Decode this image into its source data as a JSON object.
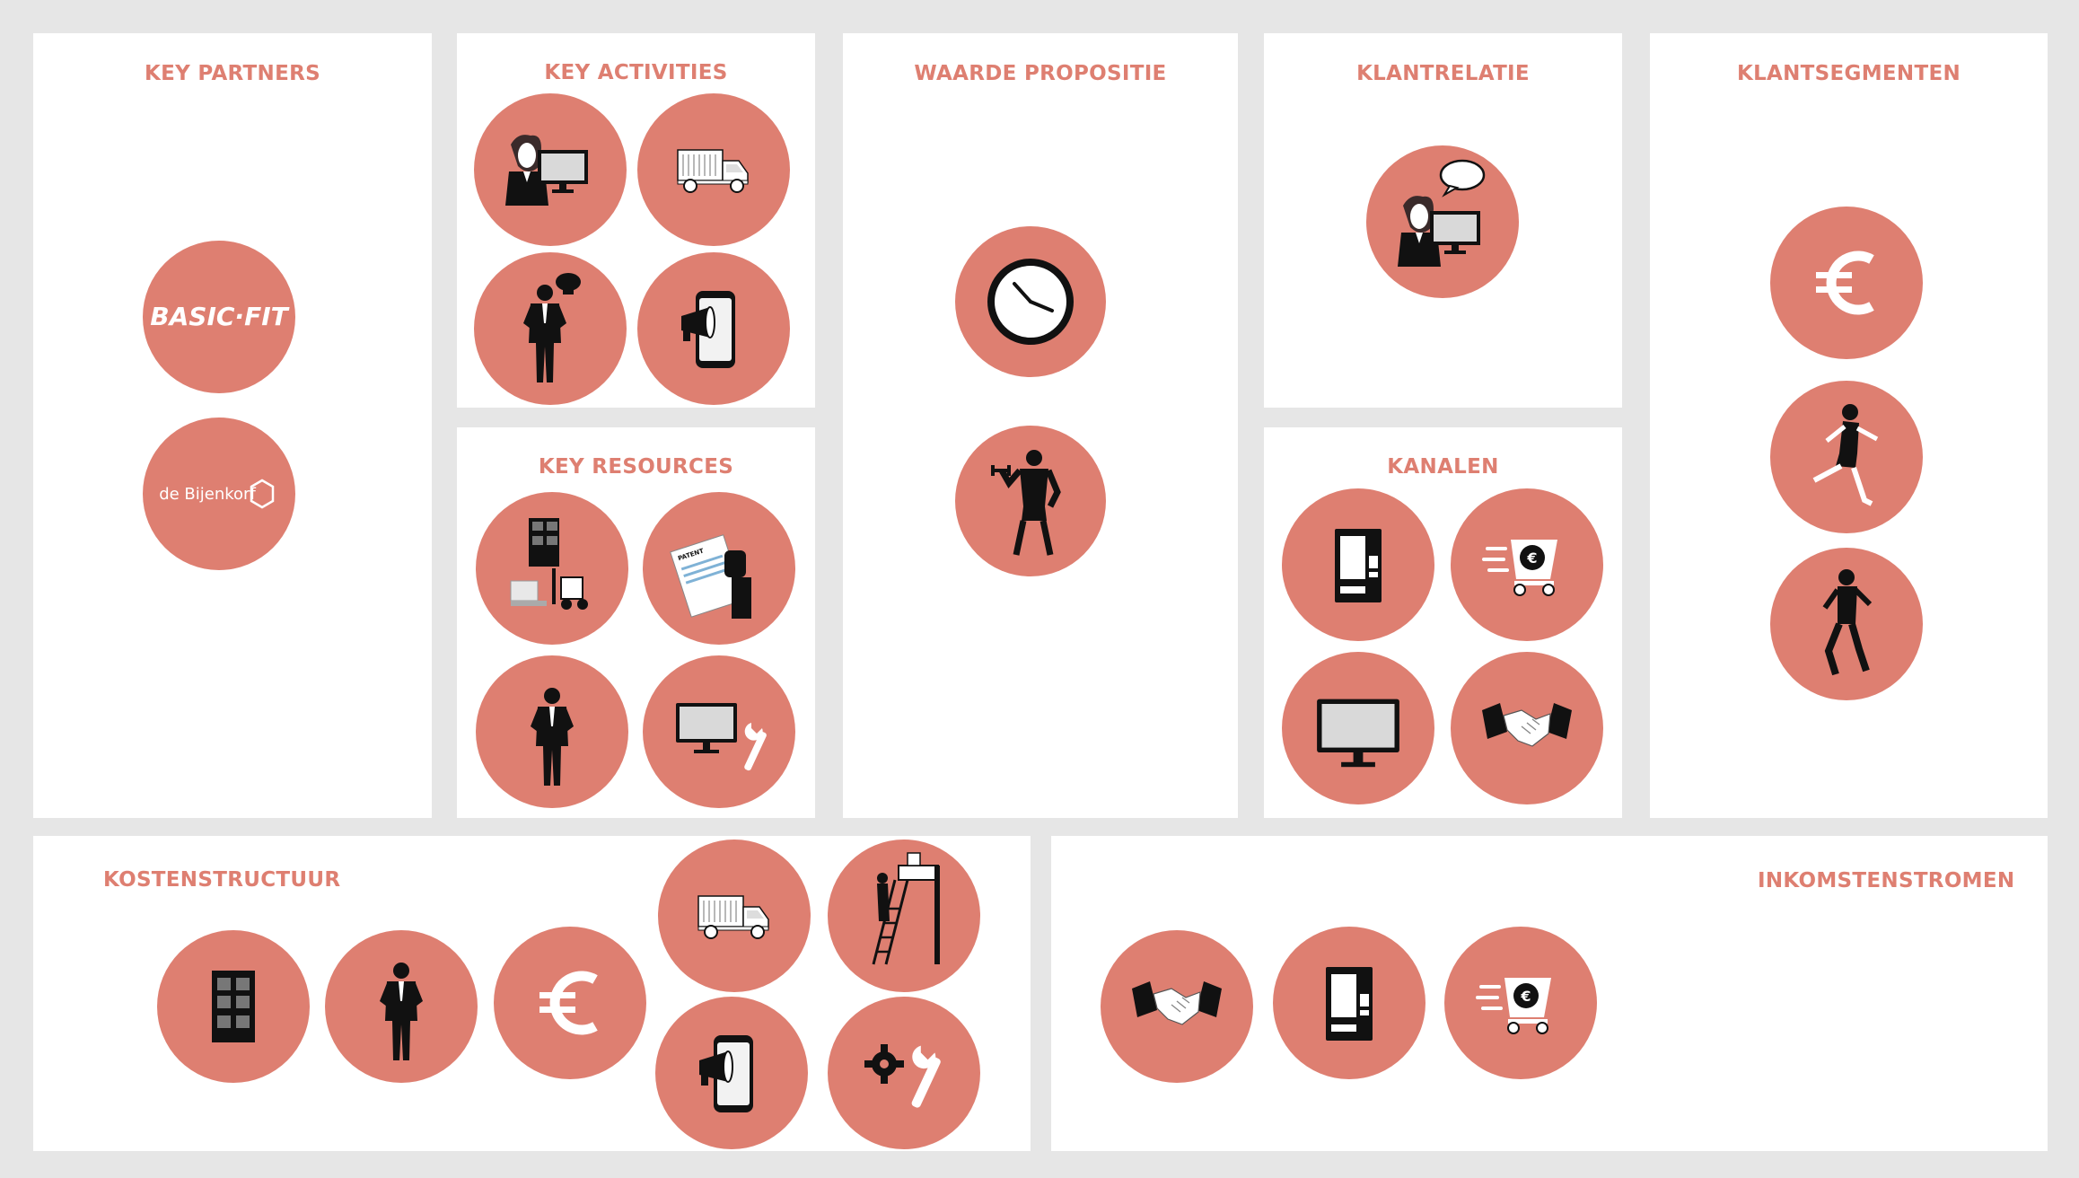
{
  "colors": {
    "accent": "#de7f71",
    "panel": "#ffffff",
    "background": "#e6e6e6",
    "ink": "#111111"
  },
  "sections": {
    "key_partners": {
      "title": "KEY PARTNERS",
      "logos": [
        "BASIC-FIT",
        "de Bijenkorf"
      ]
    },
    "key_activities": {
      "title": "KEY ACTIVITIES"
    },
    "key_resources": {
      "title": "KEY RESOURCES"
    },
    "value_proposition": {
      "title": "WAARDE PROPOSITIE"
    },
    "customer_relationships": {
      "title": "KLANTRELATIE"
    },
    "channels": {
      "title": "KANALEN"
    },
    "customer_segments": {
      "title": "KLANTSEGMENTEN"
    },
    "cost_structure": {
      "title": "KOSTENSTRUCTUUR"
    },
    "revenue_streams": {
      "title": "INKOMSTENSTROMEN"
    }
  },
  "icons": {
    "key_activities": [
      "support-agent-icon",
      "delivery-truck-icon",
      "chef-icon",
      "phone-megaphone-icon"
    ],
    "key_resources": [
      "warehouse-forklift-icon",
      "patent-document-icon",
      "businessman-icon",
      "monitor-wrench-icon"
    ],
    "value_proposition": [
      "clock-icon",
      "dumbbell-athlete-icon"
    ],
    "customer_relationships": [
      "support-agent-chat-icon"
    ],
    "channels": [
      "vending-machine-icon",
      "shopping-cart-euro-icon",
      "monitor-icon",
      "handshake-icon"
    ],
    "customer_segments": [
      "euro-icon",
      "runner-woman-icon",
      "runner-man-icon"
    ],
    "cost_structure": [
      "building-icon",
      "businessman-icon",
      "euro-icon",
      "delivery-truck-icon",
      "worker-ladder-icon",
      "phone-megaphone-icon",
      "gear-wrench-icon"
    ],
    "revenue_streams": [
      "handshake-icon",
      "vending-machine-icon",
      "shopping-cart-euro-icon"
    ]
  }
}
